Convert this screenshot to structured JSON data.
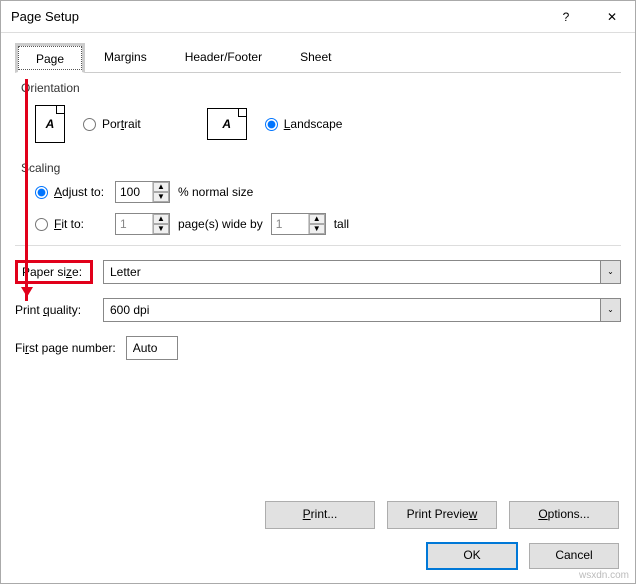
{
  "titlebar": {
    "title": "Page Setup",
    "help_label": "?",
    "close_label": "✕"
  },
  "tabs": {
    "page": "Page",
    "margins": "Margins",
    "header_footer": "Header/Footer",
    "sheet": "Sheet"
  },
  "orientation": {
    "group_label": "Orientation",
    "portrait_label": "Portrait",
    "landscape_label": "Landscape",
    "icon_letter": "A",
    "selected": "landscape"
  },
  "scaling": {
    "group_label": "Scaling",
    "adjust_label_pre": "A",
    "adjust_label": "djust to:",
    "adjust_value": "100",
    "adjust_suffix": "% normal size",
    "fit_label_pre": "F",
    "fit_label": "it to:",
    "fit_wide_value": "1",
    "fit_wide_suffix": "page(s) wide by",
    "fit_tall_value": "1",
    "fit_tall_suffix": "tall",
    "selected": "adjust"
  },
  "paper": {
    "size_label": "Paper size:",
    "size_value": "Letter",
    "quality_label": "Print quality:",
    "quality_value": "600 dpi"
  },
  "first_page": {
    "label_pre": "Fi",
    "label_u": "r",
    "label_post": "st page number:",
    "value": "Auto"
  },
  "actions": {
    "print": "Print...",
    "preview": "Print Preview",
    "options": "Options..."
  },
  "footer": {
    "ok": "OK",
    "cancel": "Cancel"
  },
  "watermark": "wsxdn.com"
}
